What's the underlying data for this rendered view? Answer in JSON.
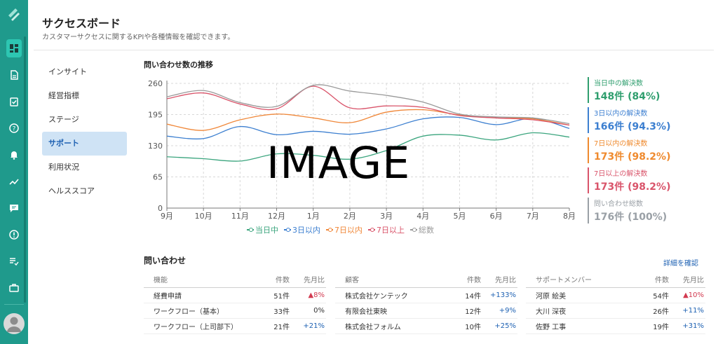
{
  "header": {
    "title": "サクセスボード",
    "subtitle": "カスタマーサクセスに関するKPIや各種情報を確認できます。"
  },
  "sidebar": {
    "icons": [
      "dashboard-icon",
      "document-icon",
      "check-icon",
      "help-icon",
      "bell-icon",
      "trend-icon",
      "chat-icon",
      "info-icon",
      "list-check-icon",
      "briefcase-icon"
    ]
  },
  "subnav": {
    "items": [
      {
        "label": "インサイト",
        "active": false
      },
      {
        "label": "経営指標",
        "active": false
      },
      {
        "label": "ステージ",
        "active": false
      },
      {
        "label": "サポート",
        "active": true
      },
      {
        "label": "利用状況",
        "active": false
      },
      {
        "label": "ヘルススコア",
        "active": false
      }
    ]
  },
  "placeholder": "IMAGE",
  "chart_data": {
    "type": "line",
    "title": "問い合わせ数の推移",
    "categories": [
      "9月",
      "10月",
      "11月",
      "12月",
      "1月",
      "2月",
      "3月",
      "4月",
      "5月",
      "6月",
      "7月",
      "8月"
    ],
    "ylim": [
      0,
      260
    ],
    "yticks": [
      0,
      65,
      130,
      195,
      260
    ],
    "grid": true,
    "legend_position": "bottom",
    "series": [
      {
        "name": "当日中",
        "color": "#3ba57e",
        "values": [
          107,
          103,
          98,
          113,
          110,
          102,
          120,
          150,
          152,
          142,
          157,
          148
        ]
      },
      {
        "name": "3日以内",
        "color": "#3c7fd0",
        "values": [
          150,
          145,
          170,
          153,
          160,
          154,
          165,
          186,
          189,
          174,
          187,
          166
        ]
      },
      {
        "name": "7日以内",
        "color": "#f0883a",
        "values": [
          175,
          162,
          184,
          196,
          188,
          178,
          200,
          205,
          194,
          188,
          186,
          173
        ]
      },
      {
        "name": "7日以上",
        "color": "#d9546a",
        "values": [
          228,
          240,
          217,
          207,
          254,
          209,
          213,
          210,
          193,
          188,
          184,
          173
        ]
      },
      {
        "name": "総数",
        "color": "#999999",
        "values": [
          232,
          245,
          220,
          212,
          256,
          244,
          235,
          221,
          196,
          190,
          188,
          176
        ]
      }
    ]
  },
  "stats": [
    {
      "label": "当日中の解決数",
      "value": "148件 (84%)",
      "color": "#2f9e6e"
    },
    {
      "label": "3日以内の解決数",
      "value": "166件 (94.3%)",
      "color": "#3c7fd0"
    },
    {
      "label": "7日以内の解決数",
      "value": "173件 (98.2%)",
      "color": "#ef8a2e"
    },
    {
      "label": "7日以上の解決数",
      "value": "173件 (98.2%)",
      "color": "#d9546a"
    },
    {
      "label": "問い合わせ総数",
      "value": "176件 (100%)",
      "color": "#9aa0a6"
    }
  ],
  "inquiries": {
    "title": "問い合わせ",
    "detail_link": "詳細を確認",
    "tables": [
      {
        "headers": [
          "機能",
          "件数",
          "先月比"
        ],
        "rows": [
          {
            "name": "経費申請",
            "count": "51件",
            "change": "▲8%",
            "trend": "down"
          },
          {
            "name": "ワークフロー（基本）",
            "count": "33件",
            "change": "0%",
            "trend": "flat"
          },
          {
            "name": "ワークフロー（上司部下）",
            "count": "21件",
            "change": "+21%",
            "trend": "up"
          }
        ]
      },
      {
        "headers": [
          "顧客",
          "件数",
          "先月比"
        ],
        "rows": [
          {
            "name": "株式会社ケンテック",
            "count": "14件",
            "change": "+133%",
            "trend": "up"
          },
          {
            "name": "有限会社東映",
            "count": "12件",
            "change": "+9%",
            "trend": "up"
          },
          {
            "name": "株式会社フォルム",
            "count": "10件",
            "change": "+25%",
            "trend": "up"
          }
        ]
      },
      {
        "headers": [
          "サポートメンバー",
          "件数",
          "先月比"
        ],
        "rows": [
          {
            "name": "河原 絵美",
            "count": "54件",
            "change": "▲10%",
            "trend": "down"
          },
          {
            "name": "大川 深夜",
            "count": "26件",
            "change": "+11%",
            "trend": "up"
          },
          {
            "name": "佐野 工事",
            "count": "19件",
            "change": "+31%",
            "trend": "up"
          }
        ]
      }
    ]
  }
}
